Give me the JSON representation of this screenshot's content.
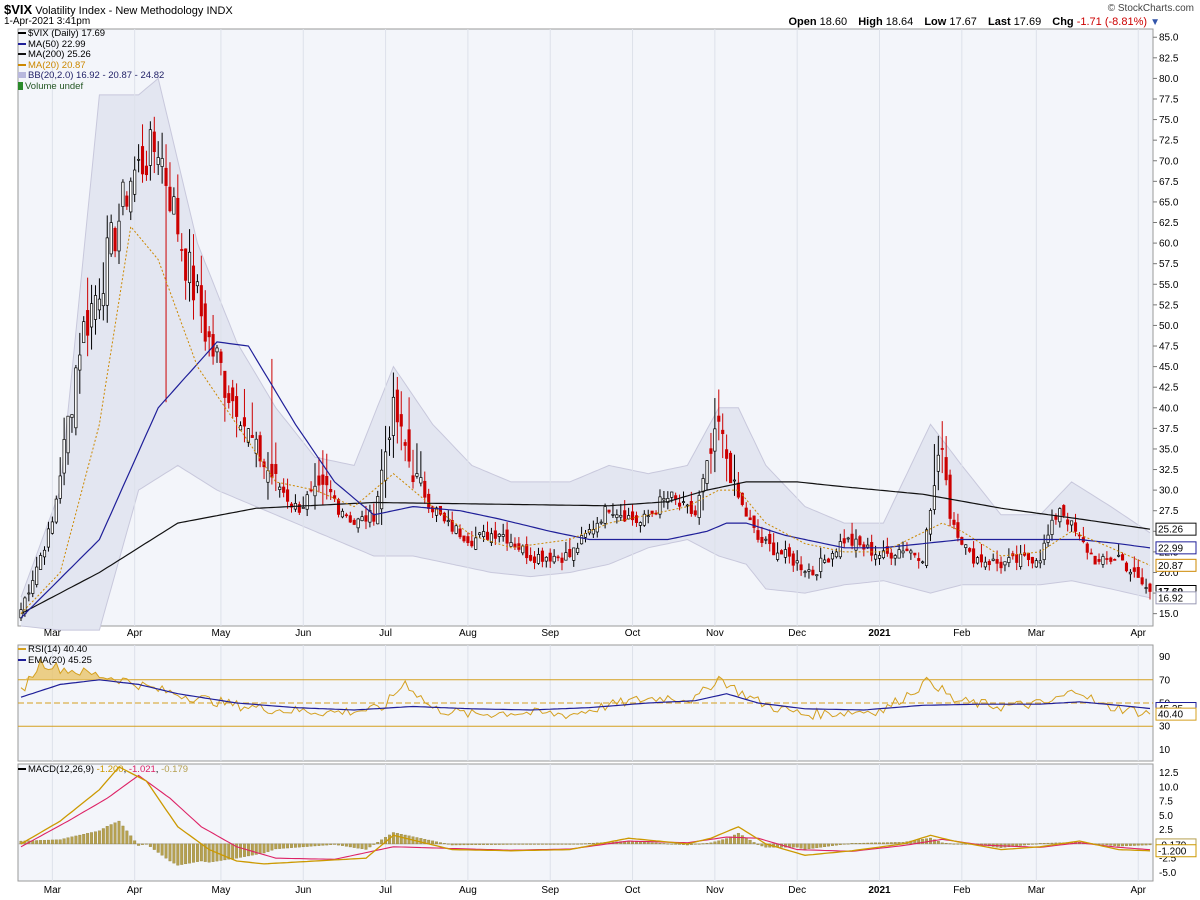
{
  "header": {
    "symbol": "$VIX",
    "name": "Volatility Index - New Methodology",
    "exchange": "INDX",
    "datetime": "1-Apr-2021 3:41pm",
    "watermark": "© StockCharts.com",
    "open_label": "Open",
    "open": "18.60",
    "high_label": "High",
    "high": "18.64",
    "low_label": "Low",
    "low": "17.67",
    "last_label": "Last",
    "last": "17.69",
    "chg_label": "Chg",
    "chg": "-1.71 (-8.81%)"
  },
  "legend_main": {
    "price": "$VIX (Daily) 17.69",
    "ma50": "MA(50) 22.99",
    "ma200": "MA(200) 25.26",
    "ma20": "MA(20) 20.87",
    "bb": "BB(20,2.0) 16.92 - 20.87 - 24.82",
    "volume": "Volume undef"
  },
  "legend_rsi": {
    "rsi": "RSI(14) 40.40",
    "ema": "EMA(20) 45.25"
  },
  "legend_macd": {
    "label": "MACD(12,26,9)",
    "v1": "-1.200",
    "v2": "-1.021",
    "v3": "-0.179"
  },
  "colors": {
    "up": "#000000",
    "down": "#cc0000",
    "ma50": "#1f1f99",
    "ma200": "#111111",
    "ma20": "#cc8800",
    "bb": "#c8c8dc",
    "rsi": "#d4a020",
    "macd_line": "#cc9900",
    "signal": "#dd2266",
    "hist": "#b5a050"
  },
  "chart_data": [
    {
      "type": "line",
      "title": "$VIX (Daily) 17.69",
      "x_ticks": [
        "Mar",
        "Apr",
        "May",
        "Jun",
        "Jul",
        "Aug",
        "Sep",
        "Oct",
        "Nov",
        "Dec",
        "2021",
        "Feb",
        "Mar",
        "Apr"
      ],
      "y_ticks": [
        "15.0",
        "17.5",
        "20.0",
        "22.5",
        "25.0",
        "27.5",
        "30.0",
        "32.5",
        "35.0",
        "37.5",
        "40.0",
        "42.5",
        "45.0",
        "47.5",
        "50.0",
        "52.5",
        "55.0",
        "57.5",
        "60.0",
        "62.5",
        "65.0",
        "67.5",
        "70.0",
        "72.5",
        "75.0",
        "77.5",
        "80.0",
        "82.5",
        "85.0"
      ],
      "ylim": [
        13.5,
        86
      ],
      "y_tags": [
        {
          "value": 25.26,
          "label": "25.26"
        },
        {
          "value": 22.99,
          "label": "22.99"
        },
        {
          "value": 20.87,
          "label": "20.87"
        },
        {
          "value": 17.69,
          "label": "17.69"
        },
        {
          "value": 16.92,
          "label": "16.92"
        }
      ],
      "close_anchors": [
        [
          0,
          15.5
        ],
        [
          8,
          26
        ],
        [
          15,
          48
        ],
        [
          22,
          58
        ],
        [
          28,
          68
        ],
        [
          35,
          72
        ],
        [
          42,
          58
        ],
        [
          48,
          48
        ],
        [
          55,
          40
        ],
        [
          62,
          33
        ],
        [
          70,
          28
        ],
        [
          78,
          30
        ],
        [
          85,
          26
        ],
        [
          90,
          27
        ],
        [
          95,
          40
        ],
        [
          100,
          32
        ],
        [
          108,
          26
        ],
        [
          115,
          24
        ],
        [
          122,
          25
        ],
        [
          130,
          22
        ],
        [
          140,
          22
        ],
        [
          150,
          28
        ],
        [
          158,
          26
        ],
        [
          165,
          29
        ],
        [
          172,
          27
        ],
        [
          178,
          38
        ],
        [
          182,
          30
        ],
        [
          188,
          24
        ],
        [
          195,
          22
        ],
        [
          202,
          20
        ],
        [
          210,
          24
        ],
        [
          220,
          22
        ],
        [
          225,
          23
        ],
        [
          230,
          22
        ],
        [
          235,
          36
        ],
        [
          237,
          27
        ],
        [
          242,
          22
        ],
        [
          250,
          21
        ],
        [
          260,
          22
        ],
        [
          265,
          28
        ],
        [
          270,
          24
        ],
        [
          275,
          21
        ],
        [
          280,
          22
        ],
        [
          285,
          19
        ],
        [
          288,
          17.69
        ]
      ],
      "ma50_anchors": [
        [
          0,
          14.5
        ],
        [
          20,
          24
        ],
        [
          35,
          40
        ],
        [
          50,
          48
        ],
        [
          58,
          47.5
        ],
        [
          70,
          38
        ],
        [
          80,
          31
        ],
        [
          90,
          27
        ],
        [
          100,
          28
        ],
        [
          112,
          27.5
        ],
        [
          122,
          26.5
        ],
        [
          135,
          25
        ],
        [
          145,
          24
        ],
        [
          155,
          24
        ],
        [
          165,
          24
        ],
        [
          175,
          25
        ],
        [
          180,
          26
        ],
        [
          185,
          26
        ],
        [
          195,
          24.5
        ],
        [
          210,
          23
        ],
        [
          220,
          23
        ],
        [
          230,
          23.5
        ],
        [
          240,
          24
        ],
        [
          250,
          24
        ],
        [
          260,
          24
        ],
        [
          270,
          24
        ],
        [
          280,
          23.5
        ],
        [
          288,
          22.99
        ]
      ],
      "ma200_anchors": [
        [
          0,
          15
        ],
        [
          20,
          20
        ],
        [
          40,
          26
        ],
        [
          60,
          27.8
        ],
        [
          90,
          28.5
        ],
        [
          120,
          28.3
        ],
        [
          150,
          28.1
        ],
        [
          165,
          28.6
        ],
        [
          175,
          30
        ],
        [
          185,
          31
        ],
        [
          198,
          31
        ],
        [
          210,
          30.4
        ],
        [
          230,
          29.5
        ],
        [
          250,
          27.8
        ],
        [
          270,
          26.5
        ],
        [
          288,
          25.26
        ]
      ],
      "ma20_anchors": [
        [
          0,
          15
        ],
        [
          10,
          20
        ],
        [
          20,
          38
        ],
        [
          28,
          62
        ],
        [
          35,
          58
        ],
        [
          45,
          45
        ],
        [
          55,
          38
        ],
        [
          65,
          31
        ],
        [
          75,
          30
        ],
        [
          85,
          28
        ],
        [
          95,
          32
        ],
        [
          105,
          28
        ],
        [
          115,
          24.5
        ],
        [
          125,
          23
        ],
        [
          140,
          24
        ],
        [
          150,
          26
        ],
        [
          160,
          27
        ],
        [
          170,
          28
        ],
        [
          178,
          30
        ],
        [
          183,
          30
        ],
        [
          190,
          26
        ],
        [
          200,
          23.5
        ],
        [
          210,
          22.5
        ],
        [
          220,
          22.5
        ],
        [
          235,
          26
        ],
        [
          240,
          25
        ],
        [
          250,
          22
        ],
        [
          260,
          22.5
        ],
        [
          268,
          25
        ],
        [
          278,
          23
        ],
        [
          288,
          20.87
        ]
      ],
      "bb_upper_anchors": [
        [
          0,
          17
        ],
        [
          10,
          30
        ],
        [
          20,
          78
        ],
        [
          30,
          78
        ],
        [
          35,
          80
        ],
        [
          45,
          60
        ],
        [
          55,
          48
        ],
        [
          65,
          40
        ],
        [
          75,
          34
        ],
        [
          85,
          33
        ],
        [
          95,
          45
        ],
        [
          105,
          38
        ],
        [
          115,
          33
        ],
        [
          125,
          31
        ],
        [
          140,
          31
        ],
        [
          150,
          33
        ],
        [
          160,
          32
        ],
        [
          170,
          33
        ],
        [
          178,
          40
        ],
        [
          183,
          40
        ],
        [
          190,
          33
        ],
        [
          200,
          28
        ],
        [
          210,
          26
        ],
        [
          220,
          26
        ],
        [
          232,
          38
        ],
        [
          240,
          33
        ],
        [
          250,
          27
        ],
        [
          260,
          27
        ],
        [
          268,
          31
        ],
        [
          278,
          28
        ],
        [
          288,
          24.82
        ]
      ],
      "bb_lower_anchors": [
        [
          0,
          13.5
        ],
        [
          10,
          13
        ],
        [
          20,
          13
        ],
        [
          30,
          30
        ],
        [
          40,
          33
        ],
        [
          50,
          30
        ],
        [
          60,
          28
        ],
        [
          70,
          26
        ],
        [
          80,
          24
        ],
        [
          90,
          22
        ],
        [
          100,
          22
        ],
        [
          110,
          21
        ],
        [
          120,
          20
        ],
        [
          130,
          19.5
        ],
        [
          140,
          20
        ],
        [
          150,
          21
        ],
        [
          160,
          23
        ],
        [
          170,
          24
        ],
        [
          178,
          22
        ],
        [
          185,
          21
        ],
        [
          190,
          18
        ],
        [
          200,
          17.5
        ],
        [
          210,
          18.5
        ],
        [
          220,
          19
        ],
        [
          232,
          17.5
        ],
        [
          240,
          18.5
        ],
        [
          250,
          18.5
        ],
        [
          260,
          18.5
        ],
        [
          268,
          19
        ],
        [
          278,
          18
        ],
        [
          288,
          16.92
        ]
      ]
    },
    {
      "type": "line",
      "title": "RSI(14) 40.40",
      "y_ticks": [
        "10",
        "30",
        "50",
        "70",
        "90"
      ],
      "ylim": [
        0,
        100
      ],
      "levels": [
        30,
        50,
        70
      ],
      "y_tags": [
        {
          "value": 45.25,
          "label": "45.25"
        },
        {
          "value": 40.4,
          "label": "40.40"
        }
      ],
      "rsi_anchors": [
        [
          0,
          60
        ],
        [
          5,
          85
        ],
        [
          10,
          80
        ],
        [
          18,
          75
        ],
        [
          26,
          70
        ],
        [
          34,
          62
        ],
        [
          44,
          55
        ],
        [
          55,
          48
        ],
        [
          66,
          44
        ],
        [
          80,
          42
        ],
        [
          92,
          45
        ],
        [
          98,
          68
        ],
        [
          105,
          45
        ],
        [
          115,
          40
        ],
        [
          125,
          42
        ],
        [
          140,
          40
        ],
        [
          150,
          48
        ],
        [
          158,
          53
        ],
        [
          165,
          55
        ],
        [
          172,
          53
        ],
        [
          178,
          72
        ],
        [
          183,
          60
        ],
        [
          190,
          48
        ],
        [
          200,
          40
        ],
        [
          210,
          42
        ],
        [
          220,
          44
        ],
        [
          232,
          70
        ],
        [
          238,
          52
        ],
        [
          250,
          47
        ],
        [
          262,
          50
        ],
        [
          270,
          62
        ],
        [
          275,
          48
        ],
        [
          283,
          44
        ],
        [
          288,
          40.4
        ]
      ],
      "ema_anchors": [
        [
          0,
          55
        ],
        [
          10,
          66
        ],
        [
          20,
          70
        ],
        [
          30,
          66
        ],
        [
          40,
          58
        ],
        [
          55,
          50
        ],
        [
          70,
          46
        ],
        [
          85,
          44
        ],
        [
          100,
          47
        ],
        [
          115,
          45
        ],
        [
          130,
          44
        ],
        [
          145,
          46
        ],
        [
          160,
          50
        ],
        [
          172,
          52
        ],
        [
          180,
          58
        ],
        [
          188,
          50
        ],
        [
          200,
          45
        ],
        [
          215,
          44
        ],
        [
          230,
          48
        ],
        [
          245,
          49
        ],
        [
          260,
          49
        ],
        [
          270,
          51
        ],
        [
          280,
          48
        ],
        [
          288,
          45.25
        ]
      ]
    },
    {
      "type": "line",
      "title": "MACD(12,26,9)",
      "y_ticks": [
        "-5.0",
        "-2.5",
        "0.0",
        "2.5",
        "5.0",
        "7.5",
        "10.0",
        "12.5"
      ],
      "ylim": [
        -6.5,
        14
      ],
      "y_tags": [
        {
          "value": -0.179,
          "label": "-0.179"
        },
        {
          "value": -1.2,
          "label": "-1.200"
        }
      ],
      "macd_anchors": [
        [
          0,
          0
        ],
        [
          10,
          4
        ],
        [
          20,
          9.5
        ],
        [
          25,
          13.5
        ],
        [
          32,
          11
        ],
        [
          40,
          3
        ],
        [
          48,
          -1
        ],
        [
          55,
          -3
        ],
        [
          62,
          -3.5
        ],
        [
          75,
          -3
        ],
        [
          88,
          -2.5
        ],
        [
          95,
          1.5
        ],
        [
          110,
          -1
        ],
        [
          125,
          -1.2
        ],
        [
          140,
          -1
        ],
        [
          155,
          1
        ],
        [
          170,
          0
        ],
        [
          176,
          1
        ],
        [
          183,
          3
        ],
        [
          190,
          0
        ],
        [
          200,
          -2
        ],
        [
          212,
          -1.2
        ],
        [
          225,
          0
        ],
        [
          232,
          1.5
        ],
        [
          238,
          0.5
        ],
        [
          250,
          -1
        ],
        [
          260,
          -0.5
        ],
        [
          270,
          0.5
        ],
        [
          280,
          -1
        ],
        [
          288,
          -1.2
        ]
      ],
      "signal_anchors": [
        [
          0,
          -0.5
        ],
        [
          12,
          4
        ],
        [
          22,
          8
        ],
        [
          30,
          12
        ],
        [
          38,
          8
        ],
        [
          46,
          3
        ],
        [
          55,
          -0.5
        ],
        [
          65,
          -2.5
        ],
        [
          80,
          -2.7
        ],
        [
          95,
          -0.5
        ],
        [
          110,
          -0.8
        ],
        [
          125,
          -1.1
        ],
        [
          140,
          -0.9
        ],
        [
          155,
          0.5
        ],
        [
          170,
          0.2
        ],
        [
          180,
          1.2
        ],
        [
          188,
          1
        ],
        [
          198,
          -1
        ],
        [
          212,
          -1.3
        ],
        [
          225,
          -0.3
        ],
        [
          235,
          0.8
        ],
        [
          245,
          -0.2
        ],
        [
          260,
          -0.6
        ],
        [
          270,
          0.2
        ],
        [
          280,
          -0.6
        ],
        [
          288,
          -1.021
        ]
      ]
    }
  ]
}
